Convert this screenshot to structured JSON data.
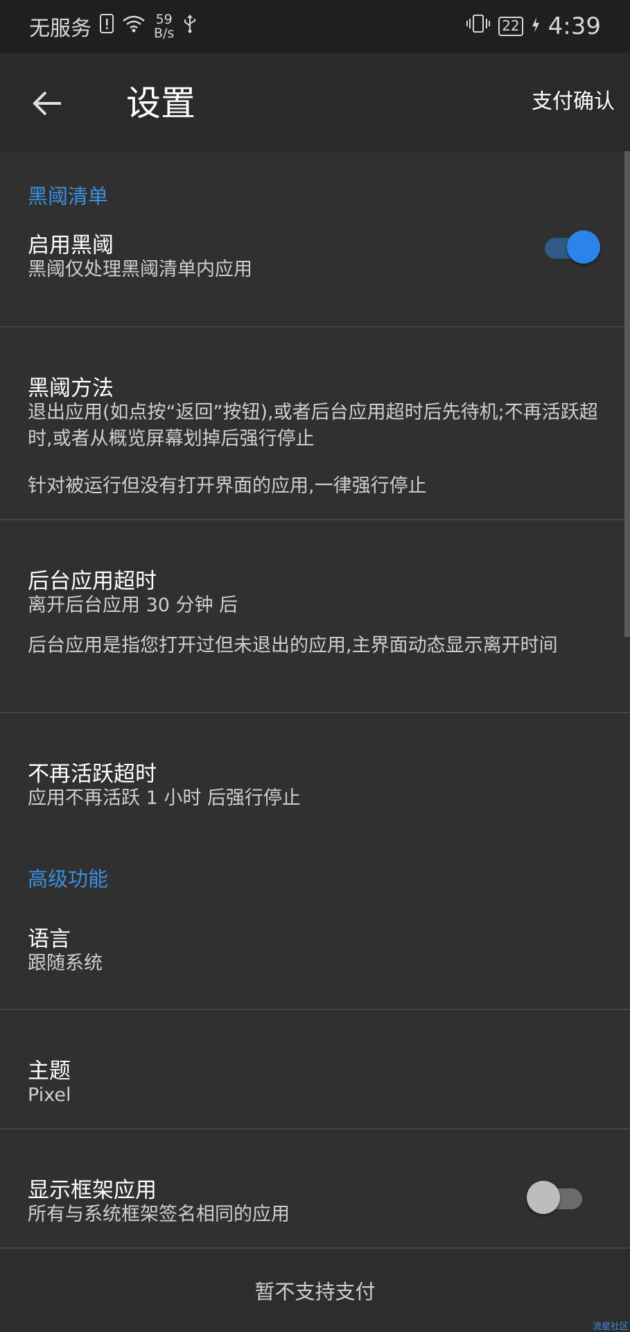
{
  "status_bar": {
    "carrier": "无服务",
    "speed_value": "59",
    "speed_unit": "B/s",
    "battery": "22",
    "time": "4:39"
  },
  "app_bar": {
    "title": "设置",
    "action": "支付确认"
  },
  "sections": {
    "blacklist_header": "黑阈清单",
    "advanced_header": "高级功能"
  },
  "settings": {
    "enable": {
      "title": "启用黑阈",
      "subtitle": "黑阈仅处理黑阈清单内应用",
      "toggle_on": true
    },
    "method": {
      "title": "黑阈方法",
      "subtitle_1": "退出应用(如点按“返回”按钮),或者后台应用超时后先待机;不再活跃超时,或者从概览屏幕划掉后强行停止",
      "subtitle_2": "针对被运行但没有打开界面的应用,一律强行停止"
    },
    "background_timeout": {
      "title": "后台应用超时",
      "subtitle_1": "离开后台应用 30 分钟 后",
      "subtitle_2": "后台应用是指您打开过但未退出的应用,主界面动态显示离开时间"
    },
    "inactive_timeout": {
      "title": "不再活跃超时",
      "subtitle": "应用不再活跃 1 小时 后强行停止"
    },
    "language": {
      "title": "语言",
      "subtitle": "跟随系统"
    },
    "theme": {
      "title": "主题",
      "subtitle": "Pixel"
    },
    "show_framework": {
      "title": "显示框架应用",
      "subtitle": "所有与系统框架签名相同的应用",
      "toggle_on": false
    }
  },
  "footer": {
    "text": "暂不支持支付"
  },
  "watermark": "流星社区",
  "colors": {
    "accent": "#3d8fe0",
    "background": "#303030",
    "toggle_on_thumb": "#2b84e8",
    "toggle_on_track": "#2e5a85",
    "toggle_off_thumb": "#bdbdbd",
    "toggle_off_track": "#6b6b6b"
  }
}
